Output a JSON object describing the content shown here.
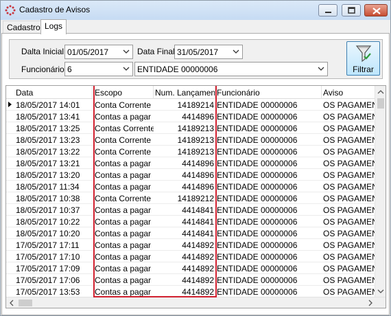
{
  "window": {
    "title": "Cadastro de Avisos"
  },
  "tabs": [
    {
      "label": "Cadastro"
    },
    {
      "label": "Logs"
    }
  ],
  "filters": {
    "data_inicial_label": "Dalta Inicial",
    "data_inicial_value": "01/05/2017",
    "data_final_label": "Data Final",
    "data_final_value": "31/05/2017",
    "funcionario_label": "Funcionário",
    "funcionario_id": "6",
    "funcionario_name": "ENTIDADE 00000006",
    "filter_button_label": "Filtrar"
  },
  "grid": {
    "columns": [
      "Data",
      "Escopo",
      "Num. Lançamento",
      "Funcionário",
      "Aviso"
    ],
    "rows": [
      {
        "data": "18/05/2017 14:01",
        "escopo": "Conta Corrente",
        "num": "14189214",
        "func": "ENTIDADE 00000006",
        "aviso": "OS PAGAMENTOS"
      },
      {
        "data": "18/05/2017 13:41",
        "escopo": "Contas a pagar",
        "num": "4414896",
        "func": "ENTIDADE 00000006",
        "aviso": "OS PAGAMENTOS"
      },
      {
        "data": "18/05/2017 13:25",
        "escopo": "Contas Corrente",
        "num": "14189213",
        "func": "ENTIDADE 00000006",
        "aviso": "OS PAGAMENTOS"
      },
      {
        "data": "18/05/2017 13:23",
        "escopo": "Conta Corrente",
        "num": "14189213",
        "func": "ENTIDADE 00000006",
        "aviso": "OS PAGAMENTOS"
      },
      {
        "data": "18/05/2017 13:22",
        "escopo": "Conta Corrente",
        "num": "14189213",
        "func": "ENTIDADE 00000006",
        "aviso": "OS PAGAMENTOS"
      },
      {
        "data": "18/05/2017 13:21",
        "escopo": "Contas a pagar",
        "num": "4414896",
        "func": "ENTIDADE 00000006",
        "aviso": "OS PAGAMENTOS"
      },
      {
        "data": "18/05/2017 13:20",
        "escopo": "Contas a pagar",
        "num": "4414896",
        "func": "ENTIDADE 00000006",
        "aviso": "OS PAGAMENTOS"
      },
      {
        "data": "18/05/2017 11:34",
        "escopo": "Contas a pagar",
        "num": "4414896",
        "func": "ENTIDADE 00000006",
        "aviso": "OS PAGAMENTOS"
      },
      {
        "data": "18/05/2017 10:38",
        "escopo": "Conta Corrente",
        "num": "14189212",
        "func": "ENTIDADE 00000006",
        "aviso": "OS PAGAMENTOS"
      },
      {
        "data": "18/05/2017 10:37",
        "escopo": "Contas a pagar",
        "num": "4414841",
        "func": "ENTIDADE 00000006",
        "aviso": "OS PAGAMENTOS"
      },
      {
        "data": "18/05/2017 10:22",
        "escopo": "Contas a pagar",
        "num": "4414841",
        "func": "ENTIDADE 00000006",
        "aviso": "OS PAGAMENTOS"
      },
      {
        "data": "18/05/2017 10:20",
        "escopo": "Contas a pagar",
        "num": "4414841",
        "func": "ENTIDADE 00000006",
        "aviso": "OS PAGAMENTOS"
      },
      {
        "data": "17/05/2017 17:11",
        "escopo": "Contas a pagar",
        "num": "4414892",
        "func": "ENTIDADE 00000006",
        "aviso": "OS PAGAMENTOS"
      },
      {
        "data": "17/05/2017 17:10",
        "escopo": "Contas a pagar",
        "num": "4414892",
        "func": "ENTIDADE 00000006",
        "aviso": "OS PAGAMENTOS"
      },
      {
        "data": "17/05/2017 17:09",
        "escopo": "Contas a pagar",
        "num": "4414892",
        "func": "ENTIDADE 00000006",
        "aviso": "OS PAGAMENTOS"
      },
      {
        "data": "17/05/2017 17:06",
        "escopo": "Contas a pagar",
        "num": "4414892",
        "func": "ENTIDADE 00000006",
        "aviso": "OS PAGAMENTOS"
      },
      {
        "data": "17/05/2017 13:53",
        "escopo": "Contas a pagar",
        "num": "4414892",
        "func": "ENTIDADE 00000006",
        "aviso": "OS PAGAMENTOS"
      }
    ]
  },
  "colors": {
    "highlight": "#d1202f",
    "filter_button": "#bee6fd",
    "close_button": "#c74d32"
  },
  "icons": [
    "app-logo-icon",
    "minimize-icon",
    "maximize-icon",
    "close-icon",
    "funnel-filter-icon",
    "chevron-down-icon",
    "row-indicator-icon"
  ]
}
